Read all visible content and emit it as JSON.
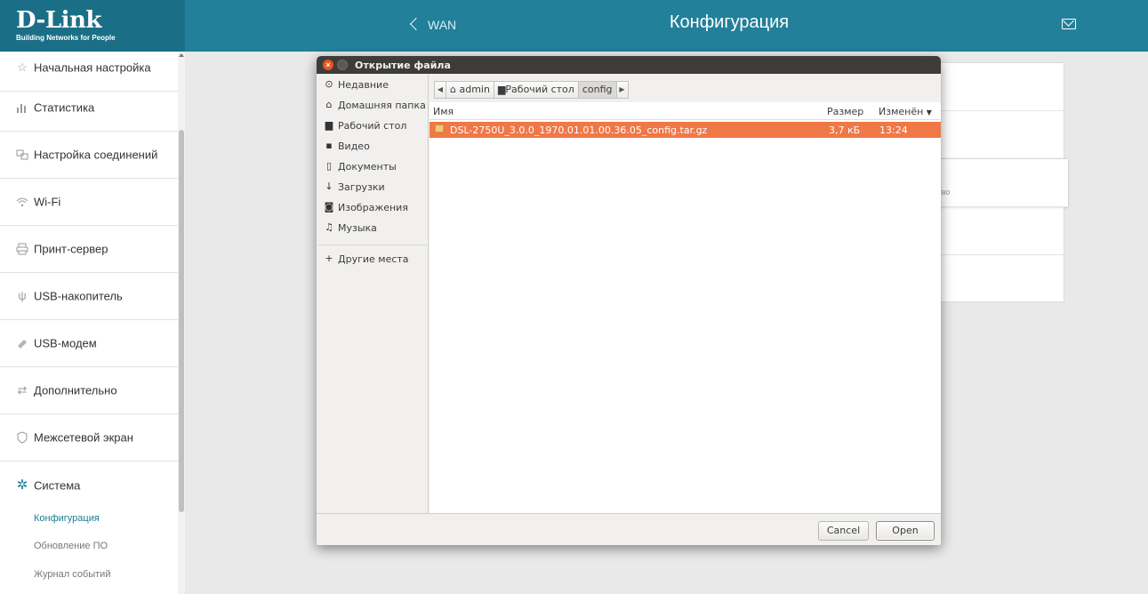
{
  "brand": {
    "name": "D-Link",
    "tagline": "Building Networks for People"
  },
  "header": {
    "back_label": "WAN",
    "title": "Конфигурация"
  },
  "sidebar": {
    "items": [
      {
        "label": "Начальная настройка",
        "icon": "star-icon"
      },
      {
        "label": "Статистика",
        "icon": "bar-chart-icon"
      },
      {
        "label": "Настройка соединений",
        "icon": "connections-icon"
      },
      {
        "label": "Wi-Fi",
        "icon": "wifi-icon"
      },
      {
        "label": "Принт-сервер",
        "icon": "printer-icon"
      },
      {
        "label": "USB-накопитель",
        "icon": "usb-icon"
      },
      {
        "label": "USB-модем",
        "icon": "modem-icon"
      },
      {
        "label": "Дополнительно",
        "icon": "arrows-icon"
      },
      {
        "label": "Межсетевой экран",
        "icon": "shield-icon"
      },
      {
        "label": "Система",
        "icon": "gear-icon"
      }
    ],
    "sub_items": [
      {
        "label": "Конфигурация",
        "active": true
      },
      {
        "label": "Обновление ПО",
        "active": false
      },
      {
        "label": "Журнал событий",
        "active": false
      }
    ]
  },
  "background_card": {
    "hint": "ство"
  },
  "dialog": {
    "title": "Открытие файла",
    "places": [
      {
        "label": "Недавние",
        "icon": "clock-icon"
      },
      {
        "label": "Домашняя папка",
        "icon": "home-icon"
      },
      {
        "label": "Рабочий стол",
        "icon": "desktop-folder-icon"
      },
      {
        "label": "Видео",
        "icon": "video-icon"
      },
      {
        "label": "Документы",
        "icon": "document-icon"
      },
      {
        "label": "Загрузки",
        "icon": "download-icon"
      },
      {
        "label": "Изображения",
        "icon": "camera-icon"
      },
      {
        "label": "Музыка",
        "icon": "music-icon"
      },
      {
        "label": "Другие места",
        "icon": "plus-icon"
      }
    ],
    "path": [
      "admin",
      "Рабочий стол",
      "config"
    ],
    "columns": {
      "name": "Имя",
      "size": "Размер",
      "modified": "Изменён"
    },
    "files": [
      {
        "name": "DSL-2750U_3.0.0_1970.01.01.00.36.05_config.tar.gz",
        "size": "3,7 кБ",
        "modified": "13:24"
      }
    ],
    "cancel_label": "Cancel",
    "open_label": "Open"
  },
  "colors": {
    "header": "#22809a",
    "selection": "#f07746",
    "accent": "#1a7d95"
  }
}
